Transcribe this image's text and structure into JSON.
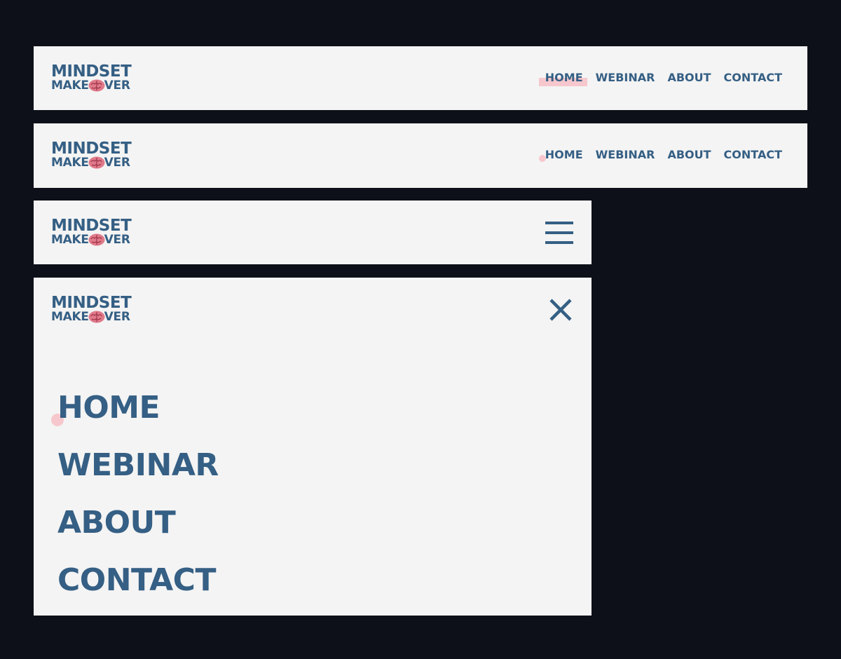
{
  "logo": {
    "line1": "MINDSET",
    "line2a": "MAKE",
    "line2b": "VER",
    "mark": "brain-icon"
  },
  "nav": {
    "home": "HOME",
    "webinar": "WEBINAR",
    "about": "ABOUT",
    "contact": "CONTACT"
  },
  "colors": {
    "background": "#0d1018",
    "panel": "#f4f4f4",
    "brand": "#355f84",
    "highlight": "#f6c8cd",
    "brain": "#e07a8a"
  },
  "icons": {
    "menu": "hamburger-menu-icon",
    "close": "close-icon"
  }
}
